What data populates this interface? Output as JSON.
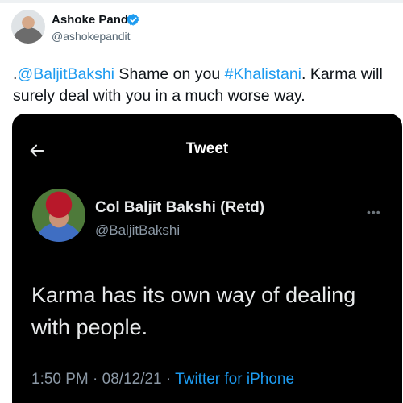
{
  "author": {
    "name": "Ashoke Pandit",
    "handle": "@ashokepandit"
  },
  "tweet": {
    "prefix": ".",
    "mention": "@BaljitBakshi",
    "text_middle": " Shame on you ",
    "hashtag": "#Khalistani",
    "text_end": ". Karma will surely deal with you in a much worse way."
  },
  "embedded": {
    "header_title": "Tweet",
    "author_name": "Col Baljit Bakshi (Retd)",
    "author_handle": "@BaljitBakshi",
    "text": "Karma has its own way of dealing with people.",
    "time": "1:50 PM",
    "date": "08/12/21",
    "separator": " · ",
    "source": "Twitter for iPhone"
  },
  "colors": {
    "link": "#1d9bf0",
    "verified": "#1d9bf0",
    "embed_background": "#000000"
  },
  "icons": {
    "verified": "verified-badge-icon",
    "back": "arrow-left-icon",
    "more": "more-dots-icon"
  }
}
